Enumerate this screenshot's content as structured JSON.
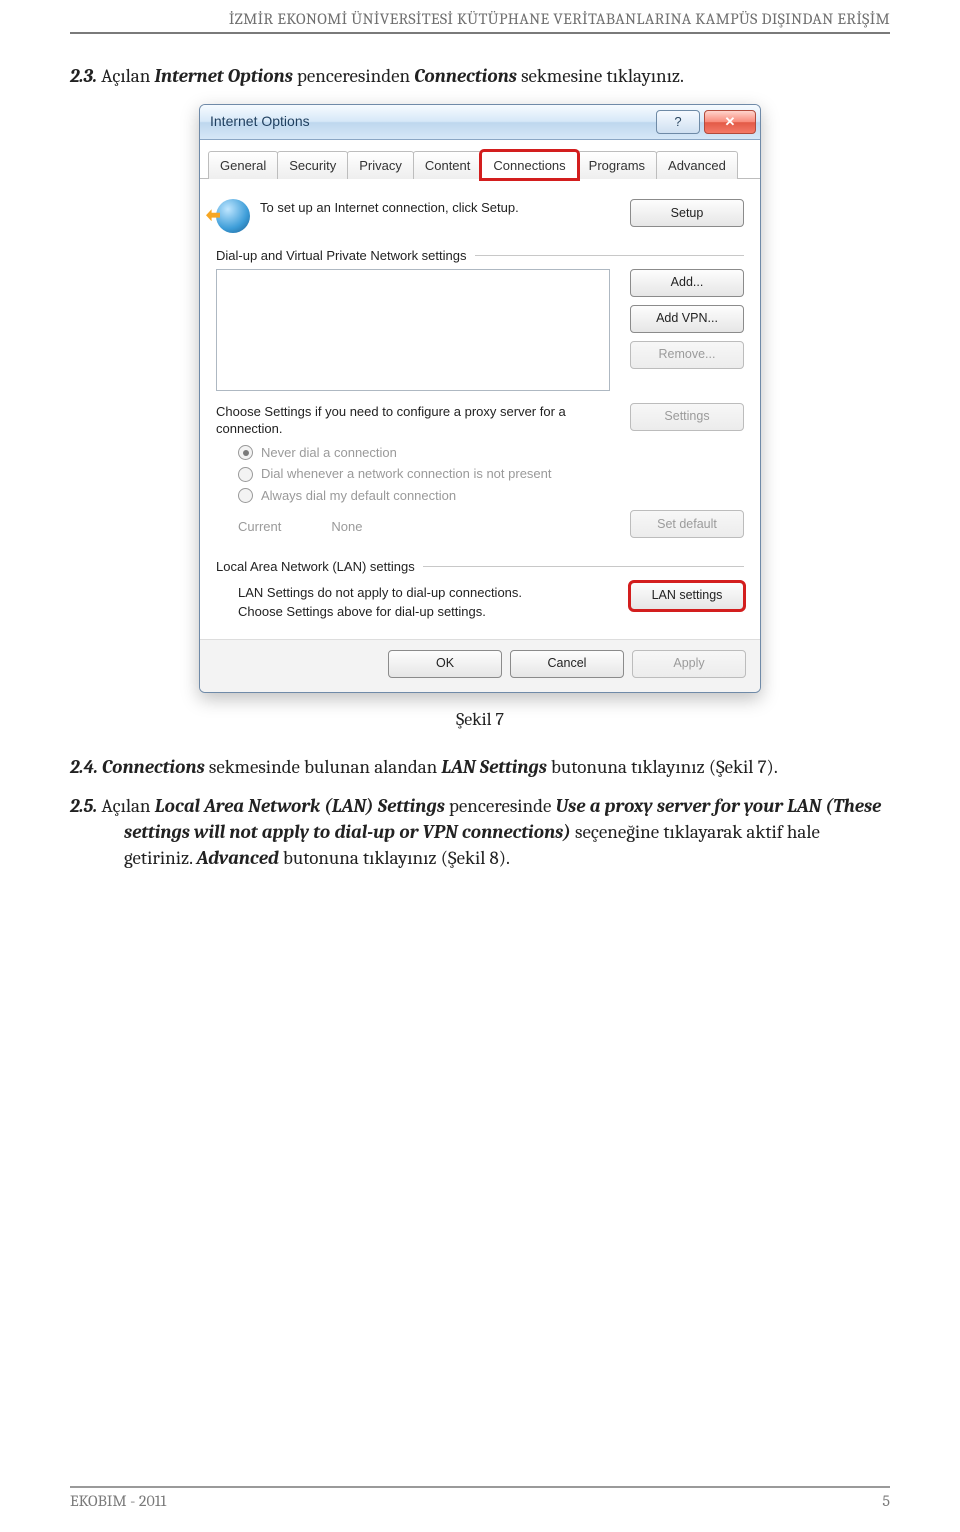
{
  "header": "İZMİR EKONOMİ ÜNİVERSİTESİ KÜTÜPHANE VERİTABANLARINA KAMPÜS DIŞINDAN ERİŞİM",
  "step23": {
    "num": "2.3.",
    "pre": " Açılan ",
    "io": "Internet Options",
    "mid": " penceresinden ",
    "conn": "Connections",
    "post": " sekmesine tıklayınız."
  },
  "caption7": "Şekil 7",
  "step24": {
    "num": "2.4.",
    "t1": "Connections",
    "mid1": " sekmesinde bulunan alandan ",
    "t2": "LAN Settings",
    "post": " butonuna tıklayınız (Şekil 7)."
  },
  "step25": {
    "num": "2.5.",
    "pre": " Açılan ",
    "t1": "Local Area Network (LAN) Settings",
    "mid1": " penceresinde ",
    "t2": "Use a proxy server for your LAN (These settings will not apply to dial-up or VPN connections)",
    "mid2": " seçeneğine tıklayarak aktif hale getiriniz. ",
    "t3": "Advanced",
    "post": " butonuna tıklayınız (Şekil 8)."
  },
  "footer": {
    "left": "EKOBIM - 2011",
    "right": "5"
  },
  "dialog": {
    "title": "Internet Options",
    "helpGlyph": "?",
    "closeGlyph": "✕",
    "tabs": [
      "General",
      "Security",
      "Privacy",
      "Content",
      "Connections",
      "Programs",
      "Advanced"
    ],
    "setupLine": "To set up an Internet connection, click Setup.",
    "setupBtn": "Setup",
    "group1": "Dial-up and Virtual Private Network settings",
    "add": "Add...",
    "addVpn": "Add VPN...",
    "remove": "Remove...",
    "proxyHint": "Choose Settings if you need to configure a proxy server for a connection.",
    "settingsBtn": "Settings",
    "radios": [
      "Never dial a connection",
      "Dial whenever a network connection is not present",
      "Always dial my default connection"
    ],
    "currentLabel": "Current",
    "currentValue": "None",
    "setDefault": "Set default",
    "group2": "Local Area Network (LAN) settings",
    "lanHint1": "LAN Settings do not apply to dial-up connections.",
    "lanHint2": "Choose Settings above for dial-up settings.",
    "lanBtn": "LAN settings",
    "ok": "OK",
    "cancel": "Cancel",
    "apply": "Apply"
  }
}
